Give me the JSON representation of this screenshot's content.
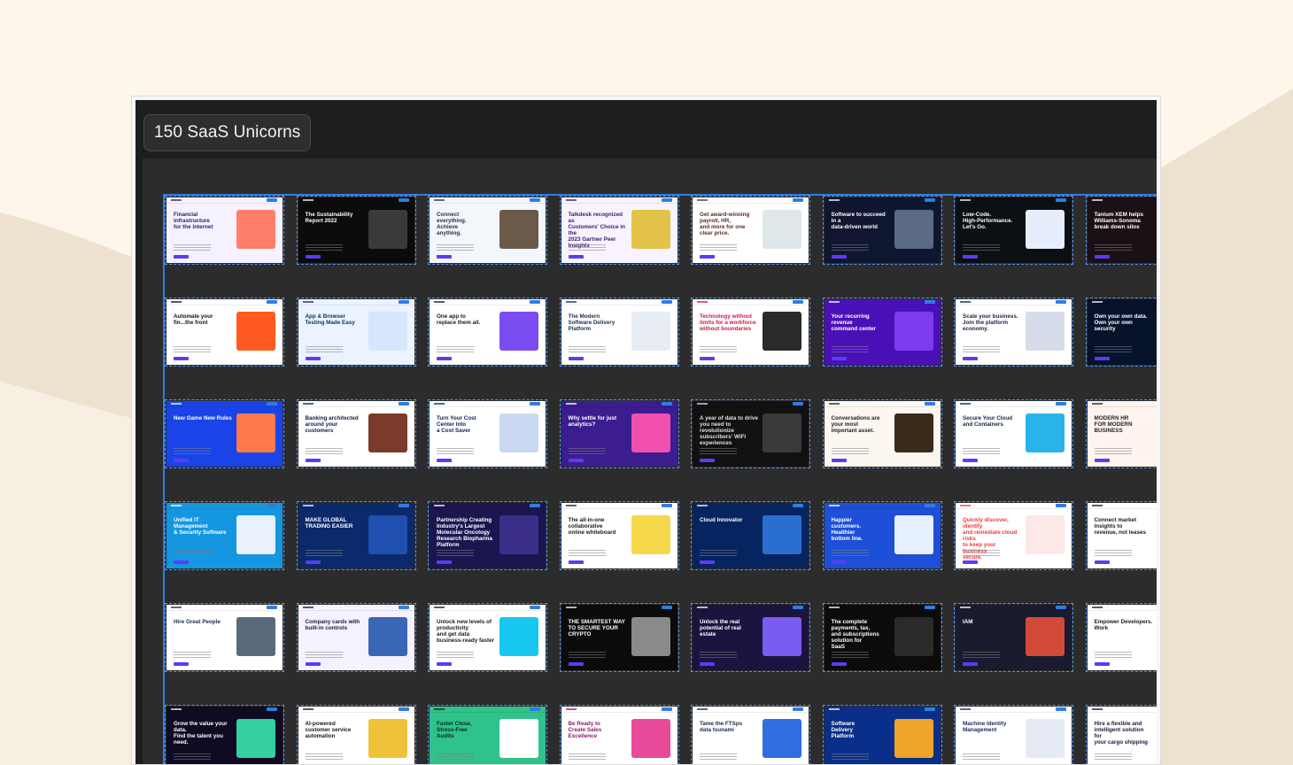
{
  "board": {
    "title": "150 SaaS Unicorns"
  },
  "colors": {
    "page_bg": "#fdf6eb",
    "blob": "#ece2cf",
    "window_bg": "#1e1e1e",
    "canvas_bg": "#2c2c2c",
    "selection_accent": "#2f7de0"
  },
  "thumbnails": [
    {
      "headline": "Financial\ninfrastructure\nfor the internet",
      "bg": "#f5f1ff",
      "fg": "#2a1d6e",
      "visual": "#ff7f6b"
    },
    {
      "headline": "The Sustainability\nReport 2022",
      "bg": "#0b0b0b",
      "fg": "#ffffff",
      "visual": "#3a3a3a"
    },
    {
      "headline": "Connect\neverything.\nAchieve\nanything.",
      "bg": "#f3f7fb",
      "fg": "#22324d",
      "visual": "#6b5a4a"
    },
    {
      "headline": "Talkdesk recognized as\nCustomers' Choice in the\n2023 Gartner Peer\nInsights",
      "bg": "#f8f4ff",
      "fg": "#3b1a74",
      "visual": "#e3c24a"
    },
    {
      "headline": "Get award-winning payroll, HR,\nand more for one clear price.",
      "bg": "#ffffff",
      "fg": "#5a2b2b",
      "visual": "#dfe7ea"
    },
    {
      "headline": "Software to succeed in a\ndata-driven world",
      "bg": "#0f1730",
      "fg": "#ffffff",
      "visual": "#5a6a84"
    },
    {
      "headline": "Low-Code.\nHigh-Performance.\nLet's Go.",
      "bg": "#0c0f14",
      "fg": "#ffffff",
      "visual": "#e7eefb"
    },
    {
      "headline": "Tanium XEM helps\nWilliams-Sonoma\nbreak down silos",
      "bg": "#1a1016",
      "fg": "#ffffff",
      "visual": "#6a3c44"
    },
    {
      "headline": "Automate your\nfin...the front",
      "bg": "#ffffff",
      "fg": "#111111",
      "visual": "#ff5a1f"
    },
    {
      "headline": "App & Browser Testing Made Easy",
      "bg": "#eaf3ff",
      "fg": "#12305a",
      "visual": "#d6e6fb"
    },
    {
      "headline": "One app to\nreplace them all.",
      "bg": "#ffffff",
      "fg": "#1a1a1a",
      "visual": "#7a4cf2"
    },
    {
      "headline": "The Modern\nSoftware Delivery\nPlatform",
      "bg": "#ffffff",
      "fg": "#1d2b4f",
      "visual": "#e7ecf5"
    },
    {
      "headline": "Technology without\nlimits for a workforce\nwithout boundaries",
      "bg": "#ffffff",
      "fg": "#c81e4a",
      "visual": "#2a2a2a"
    },
    {
      "headline": "Your recurring revenue\ncommand center",
      "bg": "#4a10b8",
      "fg": "#ffffff",
      "visual": "#7d3cf0"
    },
    {
      "headline": "Scale your business.\nJoin the platform\neconomy.",
      "bg": "#ffffff",
      "fg": "#1a2340",
      "visual": "#d7dcea"
    },
    {
      "headline": "Own your own data.\nOwn your own security",
      "bg": "#07122b",
      "fg": "#ffffff",
      "visual": "#1b4fb0"
    },
    {
      "headline": "New Game New Rules",
      "bg": "#1a44e8",
      "fg": "#ffffff",
      "visual": "#ff7a4a"
    },
    {
      "headline": "Banking architected\naround your customers",
      "bg": "#ffffff",
      "fg": "#0d1e4a",
      "visual": "#7a3b2a"
    },
    {
      "headline": "Turn Your Cost\nCenter Into\na Cost Saver",
      "bg": "#ffffff",
      "fg": "#10225a",
      "visual": "#c9d9f2"
    },
    {
      "headline": "Why settle for just\nanalytics?",
      "bg": "#3b1d8f",
      "fg": "#ffffff",
      "visual": "#f04fb0"
    },
    {
      "headline": "A year of data to drive\nyou need to revolutionize\nsubscribers' WiFi experiences",
      "bg": "#111111",
      "fg": "#e0e0e0",
      "visual": "#3a3a3a"
    },
    {
      "headline": "Conversations are your most\nimportant asset.",
      "bg": "#fbf6ef",
      "fg": "#222222",
      "visual": "#3b2a1a"
    },
    {
      "headline": "Secure Your Cloud\nand Containers",
      "bg": "#ffffff",
      "fg": "#13244a",
      "visual": "#2ab3e8"
    },
    {
      "headline": "MODERN HR\nFOR MODERN\nBUSINESS",
      "bg": "#fff4ee",
      "fg": "#222222",
      "visual": "#f0b38a"
    },
    {
      "headline": "Unified IT Management\n& Security Software",
      "bg": "#1596e0",
      "fg": "#ffffff",
      "visual": "#e9f2fb"
    },
    {
      "headline": "MAKE GLOBAL TRADING EASIER",
      "bg": "#0b2a6b",
      "fg": "#ffffff",
      "visual": "#1f4fb0"
    },
    {
      "headline": "Partnership Creating\nIndustry's Largest\nMolecular Oncology\nResearch Biopharma\nPlatform",
      "bg": "#1c1650",
      "fg": "#ffffff",
      "visual": "#3b2f8a"
    },
    {
      "headline": "The all-in-one collaborative\nonline whiteboard",
      "bg": "#ffffff",
      "fg": "#1a1a1a",
      "visual": "#f5d84a"
    },
    {
      "headline": "Cloud Innovator",
      "bg": "#062560",
      "fg": "#ffffff",
      "visual": "#2a6fd0"
    },
    {
      "headline": "Happier\ncustomers.\nHealthier\nbottom line.",
      "bg": "#1d4fd8",
      "fg": "#ffffff",
      "visual": "#e7f0ff"
    },
    {
      "headline": "Quickly discover, identify\nand remediate cloud risks\nto keep your business\nsecure.",
      "bg": "#ffffff",
      "fg": "#ee3b3b",
      "visual": "#fde8e8"
    },
    {
      "headline": "Connect market insights to\nrevenue, not leases",
      "bg": "#ffffff",
      "fg": "#1a1a1a",
      "visual": "#e6eaf2"
    },
    {
      "headline": "Hire Great People",
      "bg": "#ffffff",
      "fg": "#1a2a4a",
      "visual": "#5a6a7a"
    },
    {
      "headline": "Company cards with\nbuilt-in controls",
      "bg": "#f4f2ff",
      "fg": "#1a1a3a",
      "visual": "#3a66b8"
    },
    {
      "headline": "Unlock new levels of productivity\nand get data business-ready faster",
      "bg": "#ffffff",
      "fg": "#1a1a1a",
      "visual": "#18c7f0"
    },
    {
      "headline": "THE SMARTEST WAY\nTO SECURE YOUR\nCRYPTO",
      "bg": "#0b0b0b",
      "fg": "#ffffff",
      "visual": "#8a8a8a"
    },
    {
      "headline": "Unlock the real potential of real estate",
      "bg": "#1b1440",
      "fg": "#ffffff",
      "visual": "#7b5cf0"
    },
    {
      "headline": "The complete payments, tax,\nand subscriptions solution for\nSaaS",
      "bg": "#0c0c0c",
      "fg": "#ffffff",
      "visual": "#2a2a2a"
    },
    {
      "headline": "IAM",
      "bg": "#1a1b2e",
      "fg": "#ffffff",
      "visual": "#d44a3a"
    },
    {
      "headline": "Empower Developers. Work",
      "bg": "#ffffff",
      "fg": "#1a1a1a",
      "visual": "#e2e8f3"
    },
    {
      "headline": "Grow the value your data.\nFind the talent you need.",
      "bg": "#0e0b22",
      "fg": "#ffffff",
      "visual": "#35d0a0"
    },
    {
      "headline": "AI-powered\ncustomer service\nautomation",
      "bg": "#ffffff",
      "fg": "#1a1a1a",
      "visual": "#f0c23a"
    },
    {
      "headline": "Faster Close,\nStress-Free\nAudits",
      "bg": "#2fc28a",
      "fg": "#0b2a22",
      "visual": "#ffffff"
    },
    {
      "headline": "Be Ready to\nCreate Sales\nExcellence",
      "bg": "#ffffff",
      "fg": "#8a1a6a",
      "visual": "#e84a9a"
    },
    {
      "headline": "Tame the FTSps\ndata tsunami",
      "bg": "#ffffff",
      "fg": "#1a2a4a",
      "visual": "#2f6ee0"
    },
    {
      "headline": "Software\nDelivery\nPlatform",
      "bg": "#0a2f8a",
      "fg": "#ffffff",
      "visual": "#f0a32a"
    },
    {
      "headline": "Machine Identity\nManagement",
      "bg": "#ffffff",
      "fg": "#1a2a5a",
      "visual": "#e6eaf5"
    },
    {
      "headline": "Hire a flexible and\nintelligent solution for\nyour cargo shipping",
      "bg": "#ffffff",
      "fg": "#1a1a3a",
      "visual": "#d5d8f7"
    }
  ]
}
